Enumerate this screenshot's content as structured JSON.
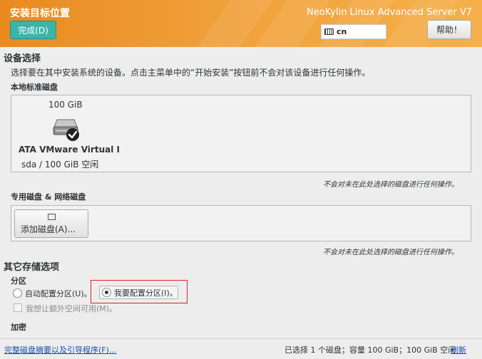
{
  "header": {
    "title": "安装目标位置",
    "done_label": "完成(D)",
    "product": "NeoKylin Linux Advanced Server V7",
    "keyboard_layout": "cn",
    "help_label": "帮助！",
    "colors": {
      "bar": "#ef9a2e",
      "done_button": "#3cb4a8"
    }
  },
  "device_selection": {
    "title": "设备选择",
    "description": "选择要在其中安装系统的设备。点击主菜单中的“开始安装”按钮前不会对该设备进行任何操作。",
    "local_disks_title": "本地标准磁盘",
    "disk": {
      "size": "100 GiB",
      "icon": "hard-disk-selected-icon",
      "name": "ATA VMware Virtual I",
      "free": "sda  /  100 GiB 空闲"
    },
    "local_note": "不会对未在此处选择的磁盘进行任何操作。",
    "special_disks_title": "专用磁盘 & 网络磁盘",
    "add_disk_label": "添加磁盘(A)...",
    "special_note": "不会对未在此处选择的磁盘进行任何操作。"
  },
  "other_options": {
    "title": "其它存储选项",
    "partition_title": "分区",
    "auto_label": "自动配置分区(U)。",
    "manual_label": "我要配置分区(I)。",
    "extra_space_label": "我想让额外空间可用(M)。",
    "encryption_title": "加密"
  },
  "footer": {
    "summary_link": "完整磁盘摘要以及引导程序(F)...",
    "status": "已选择 1 个磁盘；容量 100 GiB；100 GiB 空闲",
    "refresh_link": "刷新"
  }
}
